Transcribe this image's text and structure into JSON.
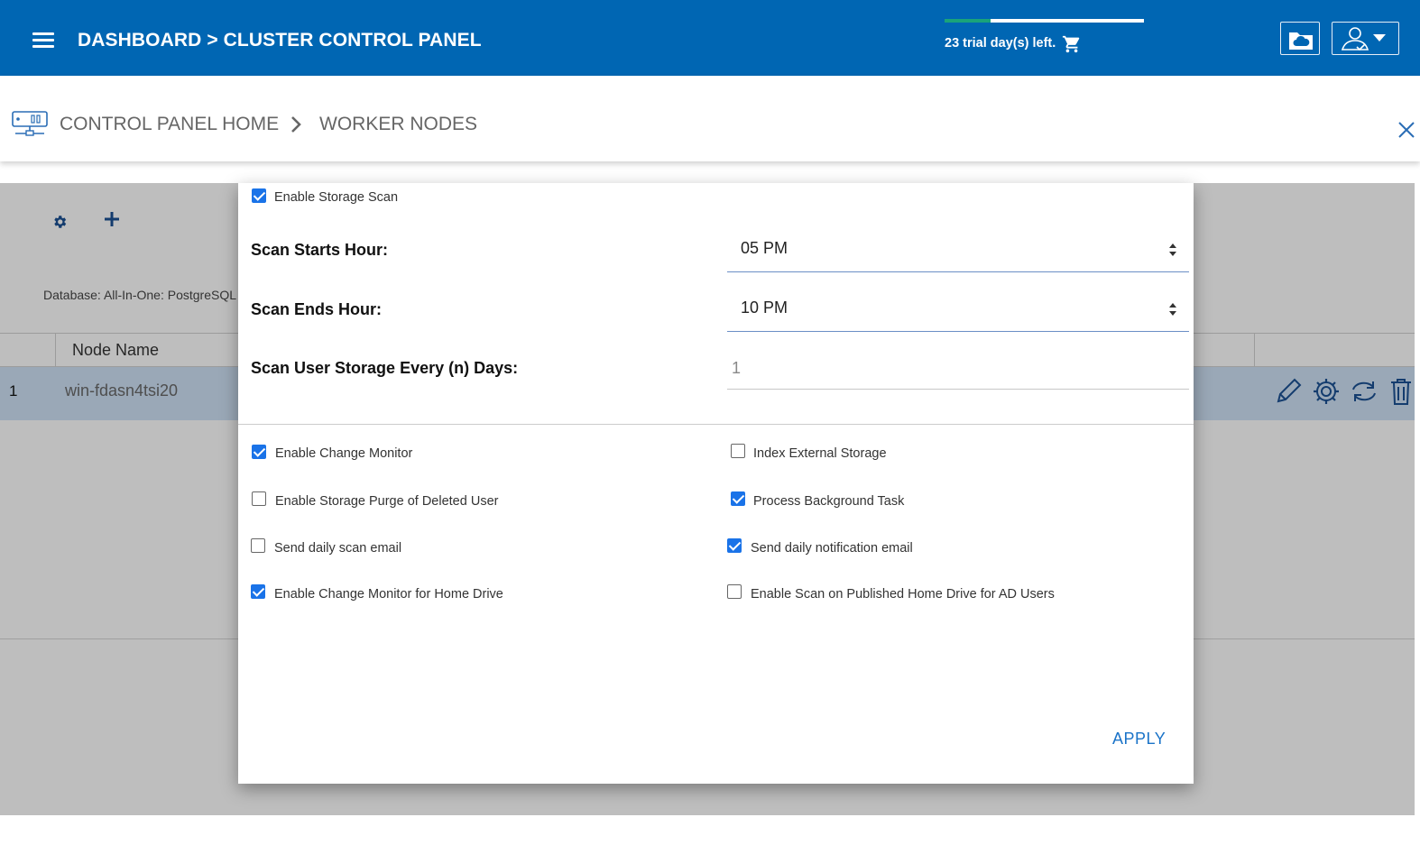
{
  "header": {
    "title": "DASHBOARD > CLUSTER CONTROL PANEL",
    "trial_text": "23 trial day(s) left.",
    "trial_progress_fraction": 0.23,
    "colors": {
      "bar": "#0066b3",
      "progress": "#1aa37a"
    }
  },
  "breadcrumb": {
    "home": "CONTROL PANEL HOME",
    "current": "WORKER NODES"
  },
  "background": {
    "database_label": "Database: All-In-One: PostgreSQL",
    "table": {
      "columns": [
        "Node Name"
      ],
      "rows": [
        {
          "index": "1",
          "node_name": "win-fdasn4tsi20"
        }
      ]
    }
  },
  "modal": {
    "enable_storage_scan": {
      "label": "Enable Storage Scan",
      "checked": true
    },
    "scan_starts_hour": {
      "label": "Scan Starts Hour:",
      "value": "05 PM"
    },
    "scan_ends_hour": {
      "label": "Scan Ends Hour:",
      "value": "10 PM"
    },
    "scan_every_days": {
      "label": "Scan User Storage Every (n) Days:",
      "value": "1"
    },
    "options_left": [
      {
        "label": "Enable Change Monitor",
        "checked": true
      },
      {
        "label": "Enable Storage Purge of Deleted User",
        "checked": false
      },
      {
        "label": "Send daily scan email",
        "checked": false
      },
      {
        "label": "Enable Change Monitor for Home Drive",
        "checked": true
      }
    ],
    "options_right": [
      {
        "label": "Index External Storage",
        "checked": false
      },
      {
        "label": "Process Background Task",
        "checked": true
      },
      {
        "label": "Send daily notification email",
        "checked": true
      },
      {
        "label": "Enable Scan on Published Home Drive for AD Users",
        "checked": false
      }
    ],
    "apply_label": "APPLY"
  }
}
